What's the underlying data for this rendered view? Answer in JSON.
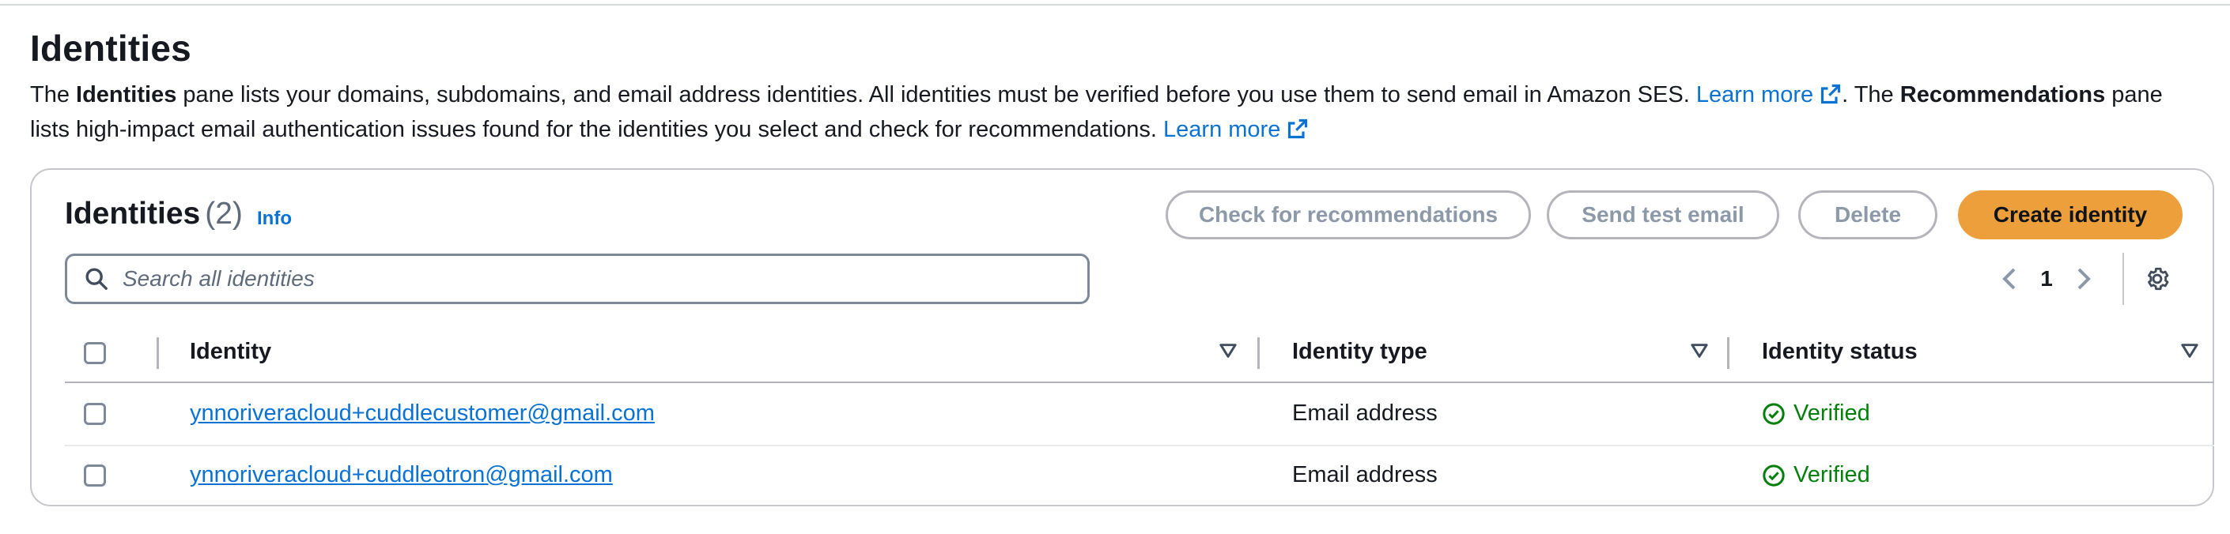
{
  "page": {
    "title": "Identities",
    "description": {
      "part1": "The ",
      "bold1": "Identities",
      "part2": " pane lists your domains, subdomains, and email address identities. All identities must be verified before you use them to send email in Amazon SES. ",
      "learn_more_1": "Learn more",
      "part3": ". The ",
      "bold2": "Recommendations",
      "part4": " pane lists high-impact email authentication issues found for the identities you select and check for recommendations. ",
      "learn_more_2": "Learn more"
    }
  },
  "panel": {
    "title": "Identities",
    "count": "(2)",
    "info": "Info",
    "buttons": {
      "check_recommendations": "Check for recommendations",
      "send_test_email": "Send test email",
      "delete": "Delete",
      "create_identity": "Create identity"
    },
    "search": {
      "placeholder": "Search all identities"
    },
    "pagination": {
      "current_page": "1"
    },
    "table": {
      "columns": [
        "Identity",
        "Identity type",
        "Identity status"
      ],
      "rows": [
        {
          "identity": "ynnoriveracloud+cuddlecustomer@gmail.com",
          "type": "Email address",
          "status": "Verified"
        },
        {
          "identity": "ynnoriveracloud+cuddleotron@gmail.com",
          "type": "Email address",
          "status": "Verified"
        }
      ]
    }
  },
  "colors": {
    "link": "#0972d3",
    "primary_button": "#ec9f3a",
    "success": "#037f0c",
    "disabled_text": "#8d99a8"
  },
  "icons": [
    "external-link-icon",
    "search-icon",
    "chevron-left-icon",
    "chevron-right-icon",
    "gear-icon",
    "sort-icon",
    "check-circle-icon"
  ]
}
